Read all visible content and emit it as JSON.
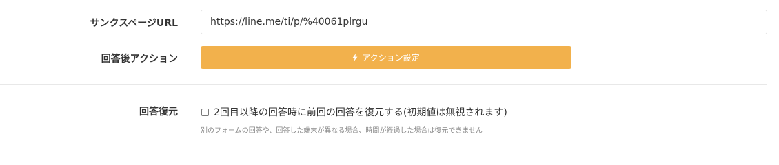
{
  "form": {
    "thanks_url": {
      "label": "サンクスページURL",
      "value": "https://line.me/ti/p/%40061plrgu"
    },
    "post_answer_action": {
      "label": "回答後アクション",
      "button_label": "アクション設定",
      "button_icon": "lightning-bolt-icon",
      "button_color": "#f2b14c"
    },
    "answer_restore": {
      "label": "回答復元",
      "checkbox_label": "2回目以降の回答時に前回の回答を復元する(初期値は無視されます)",
      "checked": false,
      "help_text": "別のフォームの回答や、回答した端末が異なる場合、時間が経過した場合は復元できません"
    }
  }
}
